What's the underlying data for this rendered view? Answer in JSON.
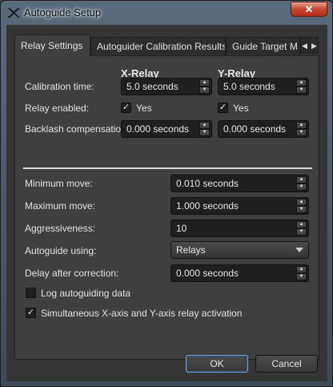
{
  "window": {
    "title": "Autoguide Setup",
    "close_glyph": "✕",
    "app_icon": "x-logo-icon"
  },
  "tabs": [
    {
      "label": "Relay Settings",
      "active": true
    },
    {
      "label": "Autoguider Calibration Results",
      "active": false
    },
    {
      "label": "Guide Target M",
      "active": false
    }
  ],
  "tab_scroll": {
    "left": "◀",
    "right": "▶"
  },
  "relay": {
    "x_header": "X-Relay",
    "y_header": "Y-Relay",
    "calibration_label": "Calibration time:",
    "calibration_x": "5.0 seconds",
    "calibration_y": "5.0 seconds",
    "relay_enabled_label": "Relay enabled:",
    "relay_enabled_x": {
      "checked": true,
      "text": "Yes"
    },
    "relay_enabled_y": {
      "checked": true,
      "text": "Yes"
    },
    "backlash_label": "Backlash compensation:",
    "backlash_x": "0.000 seconds",
    "backlash_y": "0.000 seconds"
  },
  "guide": {
    "min_move_label": "Minimum move:",
    "min_move": "0.010 seconds",
    "max_move_label": "Maximum move:",
    "max_move": "1.000 seconds",
    "aggressiveness_label": "Aggressiveness:",
    "aggressiveness": "10",
    "autoguide_using_label": "Autoguide using:",
    "autoguide_using": "Relays",
    "delay_label": "Delay after correction:",
    "delay": "0.000 seconds",
    "log_label": "Log autoguiding data",
    "log_checked": false,
    "simultaneous_label": "Simultaneous X-axis and Y-axis relay activation",
    "simultaneous_checked": true
  },
  "buttons": {
    "ok": "OK",
    "cancel": "Cancel"
  },
  "glyphs": {
    "check": "✓",
    "up": "▲",
    "down": "▼"
  },
  "colors": {
    "default_button_border": "#7aa3d6",
    "close_button": "#c6452f"
  }
}
